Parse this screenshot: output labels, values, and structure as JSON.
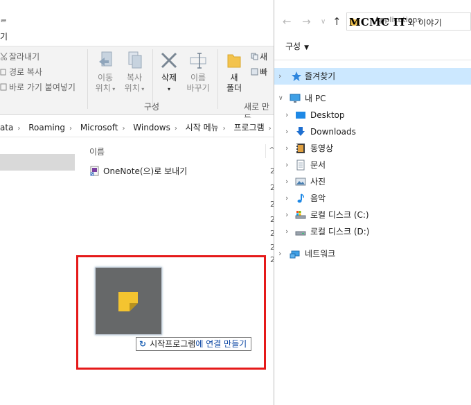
{
  "left_window": {
    "title_fragment": "ᆯ",
    "menu_fragment": "기",
    "ribbon": {
      "clipboard_items": [
        "잘라내기",
        "경로 복사",
        "바로 가기 붙여넣기"
      ],
      "move_label_1": "이동",
      "move_label_2": "위치",
      "copy_label_1": "복사",
      "copy_label_2": "위치",
      "delete_label": "삭제",
      "rename_label_1": "이름",
      "rename_label_2": "바꾸기",
      "organize_group": "구성",
      "newfolder_label_1": "새",
      "newfolder_label_2": "폴더",
      "new_group": "새로 만들",
      "new_item_1": "새",
      "new_item_2": "빠"
    },
    "breadcrumbs": [
      "ata",
      "Roaming",
      "Microsoft",
      "Windows",
      "시작 메뉴",
      "프로그램"
    ],
    "column_name": "이름",
    "files": [
      {
        "name": "OneNote(으)로 보내기"
      }
    ],
    "date_fragments": [
      "2",
      "2",
      "2",
      "2",
      "2",
      "2",
      "2"
    ]
  },
  "drag": {
    "tooltip_prefix": "시작프로그램",
    "tooltip_suffix": "에 연결 만들기",
    "link_icon": "↻"
  },
  "right_window": {
    "address_text": "Applications",
    "watermark_main": "MCMC IT",
    "watermark_sub": "와 이야기",
    "organize_label": "구성",
    "tree": [
      {
        "label": "즐겨찾기",
        "icon": "star-icon"
      },
      {
        "label": "내 PC",
        "icon": "pc-icon"
      },
      {
        "label": "Desktop",
        "icon": "desktop-icon"
      },
      {
        "label": "Downloads",
        "icon": "downloads-icon"
      },
      {
        "label": "동영상",
        "icon": "videos-icon"
      },
      {
        "label": "문서",
        "icon": "documents-icon"
      },
      {
        "label": "사진",
        "icon": "pictures-icon"
      },
      {
        "label": "음악",
        "icon": "music-icon"
      },
      {
        "label": "로컬 디스크 (C:)",
        "icon": "drive-c-icon"
      },
      {
        "label": "로컬 디스크 (D:)",
        "icon": "drive-d-icon"
      },
      {
        "label": "네트워크",
        "icon": "network-icon"
      }
    ]
  },
  "colors": {
    "highlight_border": "#e51919",
    "selected_row": "#cce8ff",
    "sticky_note": "#f4c430"
  }
}
